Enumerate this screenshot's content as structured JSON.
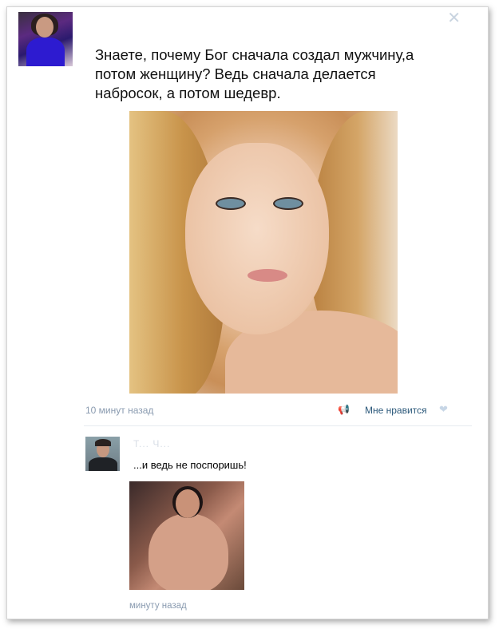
{
  "post": {
    "text": "Знаете, почему Бог сначала создал мужчину,а потом женщину? Ведь сначала делается набросок, а потом шедевр.",
    "time": "10 минут назад",
    "like_label": "Мне нравится",
    "close_glyph": "✕"
  },
  "comment": {
    "author": "Т... Ч...",
    "text": "...и ведь не поспоришь!",
    "time": "минуту назад"
  },
  "icons": {
    "close": "close-icon",
    "apple": "apple-icon",
    "megaphone": "megaphone-icon",
    "heart": "heart-icon"
  },
  "colors": {
    "link": "#2b587a",
    "meta": "#8a9bb0",
    "icon": "#c7d6e6"
  }
}
